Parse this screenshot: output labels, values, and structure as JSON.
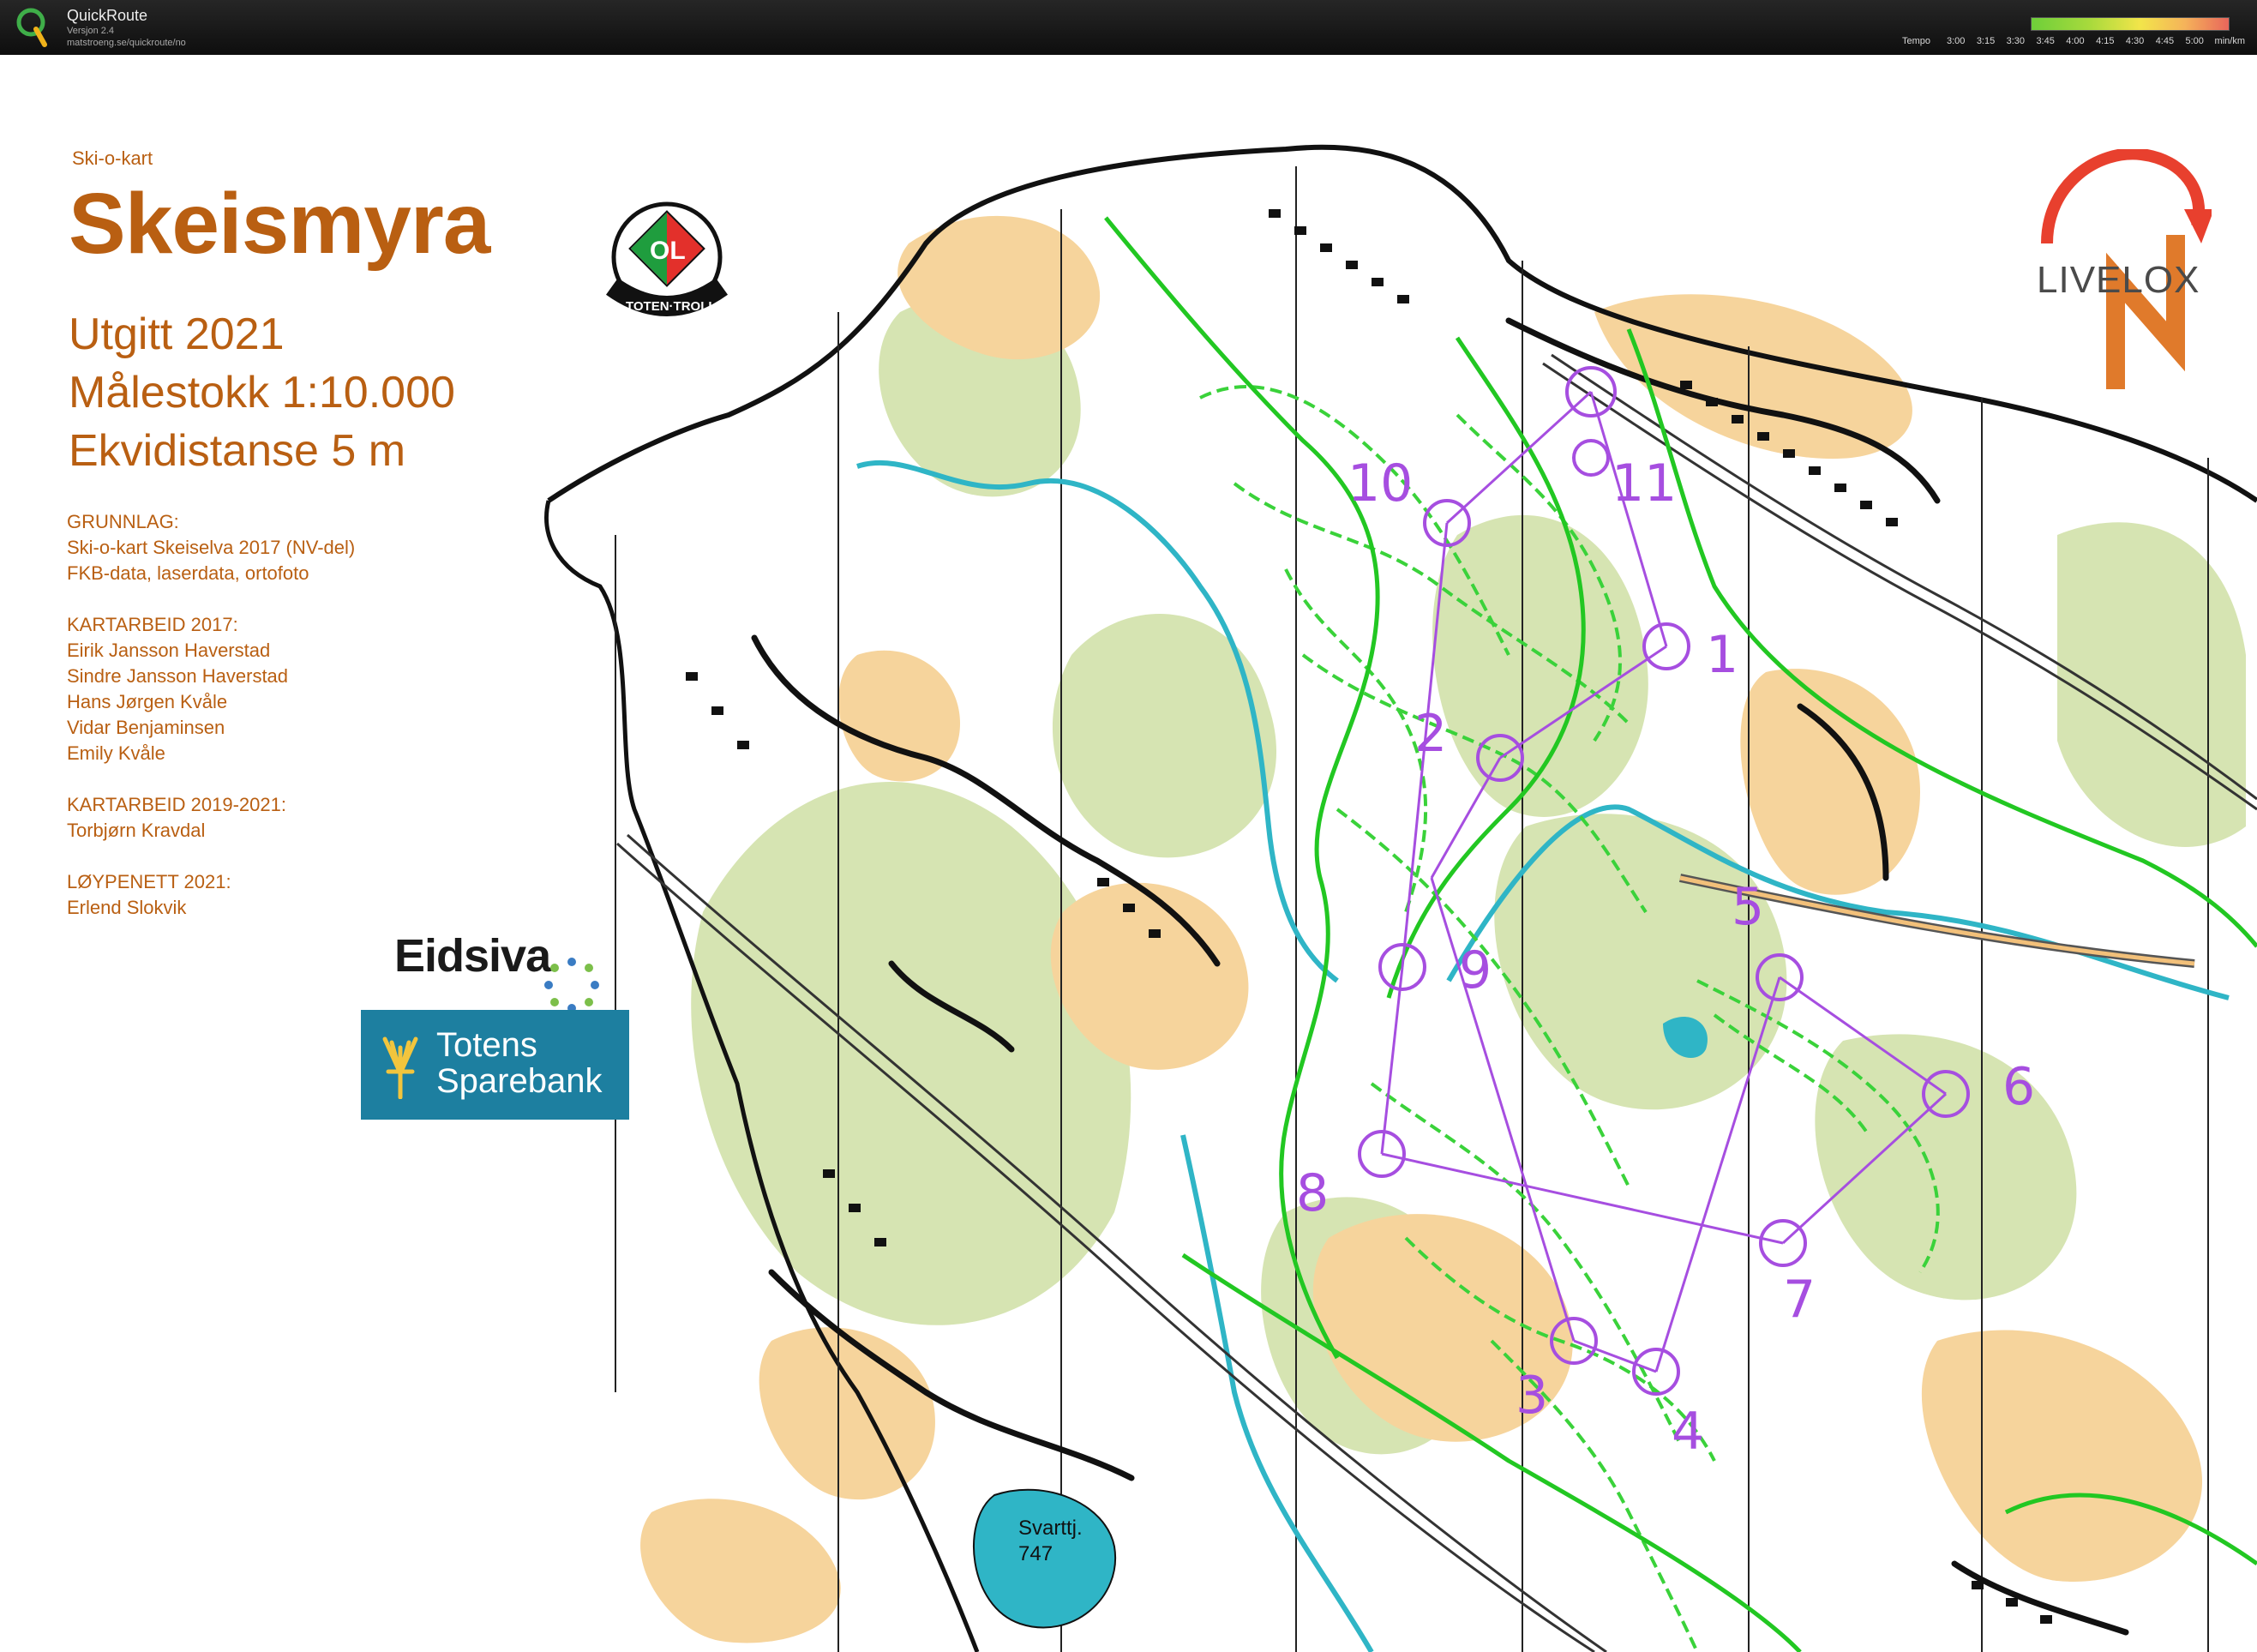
{
  "app": {
    "title": "QuickRoute",
    "version": "Versjon 2.4",
    "url": "matstroeng.se/quickroute/no"
  },
  "tempo_legend": {
    "label": "Tempo",
    "ticks": [
      "3:00",
      "3:15",
      "3:30",
      "3:45",
      "4:00",
      "4:15",
      "4:30",
      "4:45",
      "5:00"
    ],
    "unit": "min/km",
    "colors": [
      "#6ecf3a",
      "#a9da3c",
      "#f2e54a",
      "#f5b25a",
      "#e8665b"
    ]
  },
  "map": {
    "type_label": "Ski-o-kart",
    "name": "Skeismyra",
    "meta": [
      "Utgitt 2021",
      "Målestokk 1:10.000",
      "Ekvidistanse 5 m"
    ],
    "credits": [
      {
        "heading": "GRUNNLAG:",
        "lines": [
          "Ski-o-kart Skeiselva 2017 (NV-del)",
          "FKB-data, laserdata, ortofoto"
        ]
      },
      {
        "heading": "KARTARBEID 2017:",
        "lines": [
          "Eirik Jansson Haverstad",
          "Sindre Jansson Haverstad",
          "Hans Jørgen Kvåle",
          "Vidar Benjaminsen",
          "Emily Kvåle"
        ]
      },
      {
        "heading": "KARTARBEID 2019-2021:",
        "lines": [
          "Torbjørn Kravdal"
        ]
      },
      {
        "heading": "LØYPENETT 2021:",
        "lines": [
          "Erlend Slokvik"
        ]
      }
    ],
    "lake_label": [
      "Svarttj.",
      "747"
    ],
    "club_logo": {
      "letters": "OL",
      "ring_text": "TOTEN·TROLL"
    },
    "colors": {
      "text": "#b95f12",
      "course": "#a64ee0",
      "ski_track": "#2ecc2e",
      "water": "#3fb8c6",
      "open_land": "#f5d39a",
      "forest_slow": "#d8e4b4"
    }
  },
  "controls": [
    {
      "label": "1"
    },
    {
      "label": "2"
    },
    {
      "label": "3"
    },
    {
      "label": "4"
    },
    {
      "label": "5"
    },
    {
      "label": "6"
    },
    {
      "label": "7"
    },
    {
      "label": "8"
    },
    {
      "label": "9"
    },
    {
      "label": "10"
    },
    {
      "label": "11"
    }
  ],
  "sponsors": {
    "eidsiva": "Eidsiva",
    "totens_line1": "Totens",
    "totens_line2": "Sparebank"
  },
  "livelox": {
    "text": "LIVELOX"
  }
}
